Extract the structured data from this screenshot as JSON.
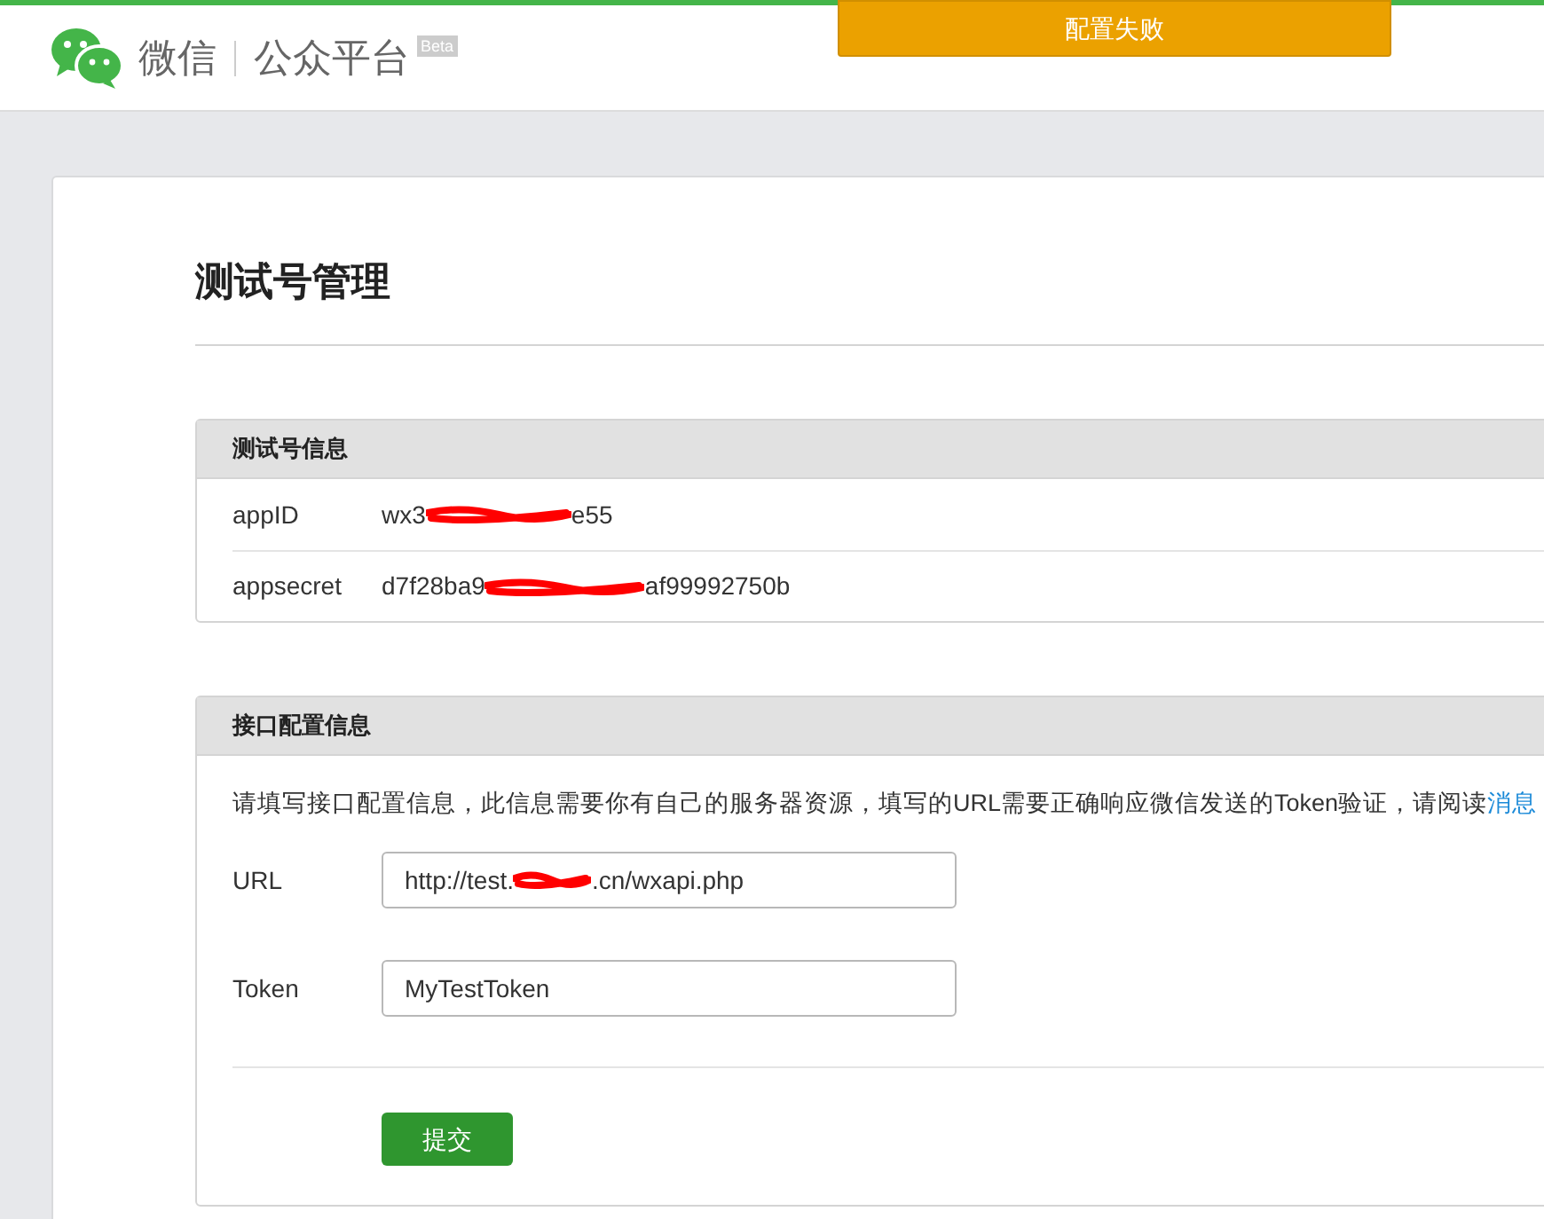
{
  "header": {
    "logo_text": "微信",
    "product": "公众平台",
    "badge": "Beta"
  },
  "toast": {
    "text": "配置失败"
  },
  "page_title": "测试号管理",
  "account_panel": {
    "title": "测试号信息",
    "rows": [
      {
        "label": "appID",
        "value_start": "wx3",
        "value_end": "e55"
      },
      {
        "label": "appsecret",
        "value_start": "d7f28ba9",
        "value_end": "af99992750b"
      }
    ]
  },
  "config_panel": {
    "title": "接口配置信息",
    "description": "请填写接口配置信息，此信息需要你有自己的服务器资源，填写的URL需要正确响应微信发送的Token验证，请阅读",
    "link": "消息",
    "fields": [
      {
        "label": "URL",
        "value_start": "http://test.",
        "value_end": ".cn/wxapi.php",
        "kind": "masked"
      },
      {
        "label": "Token",
        "value": "MyTestToken",
        "kind": "plain"
      }
    ],
    "submit": "提交"
  }
}
